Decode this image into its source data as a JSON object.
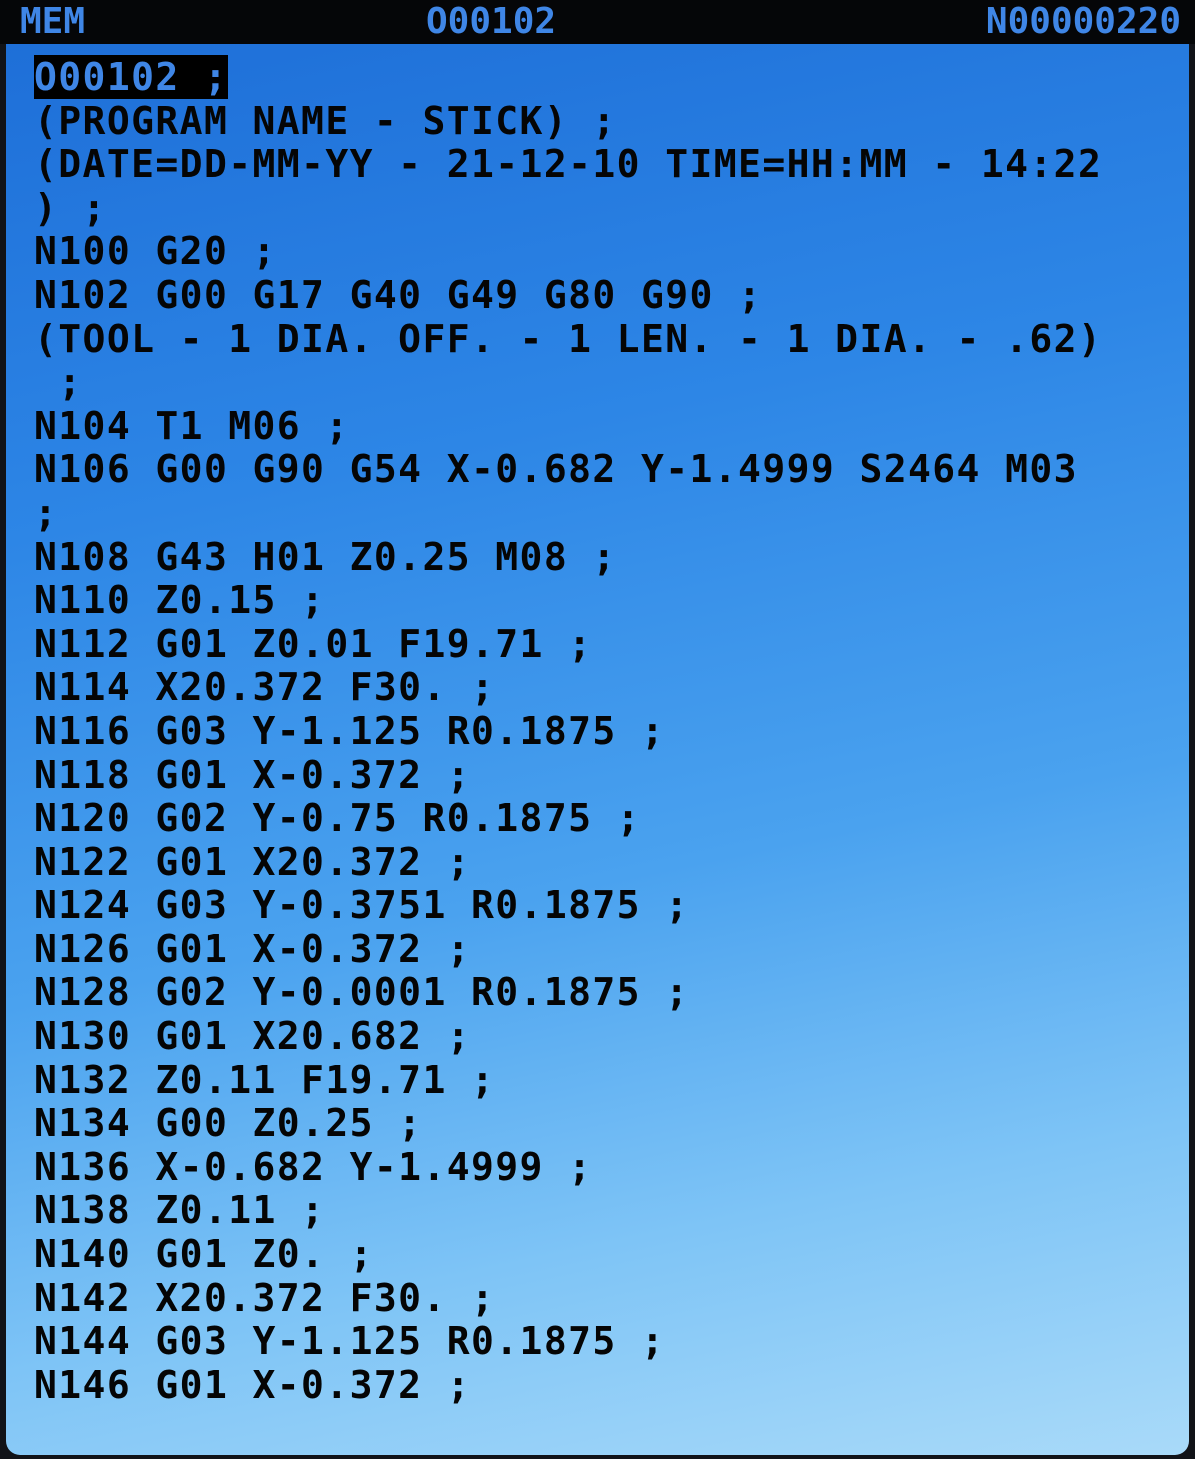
{
  "header": {
    "mode": "MEM",
    "program": "O00102",
    "sequence": "N00000220"
  },
  "program_lines": [
    "O00102 ;",
    "(PROGRAM NAME - STICK) ;",
    "(DATE=DD-MM-YY - 21-12-10 TIME=HH:MM - 14:22",
    ") ;",
    "N100 G20 ;",
    "N102 G00 G17 G40 G49 G80 G90 ;",
    "(TOOL - 1 DIA. OFF. - 1 LEN. - 1 DIA. - .62)",
    " ;",
    "N104 T1 M06 ;",
    "N106 G00 G90 G54 X-0.682 Y-1.4999 S2464 M03",
    ";",
    "N108 G43 H01 Z0.25 M08 ;",
    "N110 Z0.15 ;",
    "N112 G01 Z0.01 F19.71 ;",
    "N114 X20.372 F30. ;",
    "N116 G03 Y-1.125 R0.1875 ;",
    "N118 G01 X-0.372 ;",
    "N120 G02 Y-0.75 R0.1875 ;",
    "N122 G01 X20.372 ;",
    "N124 G03 Y-0.3751 R0.1875 ;",
    "N126 G01 X-0.372 ;",
    "N128 G02 Y-0.0001 R0.1875 ;",
    "N130 G01 X20.682 ;",
    "N132 Z0.11 F19.71 ;",
    "N134 G00 Z0.25 ;",
    "N136 X-0.682 Y-1.4999 ;",
    "N138 Z0.11 ;",
    "N140 G01 Z0. ;",
    "N142 X20.372 F30. ;",
    "N144 G03 Y-1.125 R0.1875 ;",
    "N146 G01 X-0.372 ;"
  ],
  "cursor_line": 0,
  "colors": {
    "header_background": "#050608",
    "header_text": "#3f86e6",
    "screen_gradient_top": "#1e6fd8",
    "screen_gradient_bottom": "#a9daf9",
    "program_text": "#050505",
    "cursor_background": "#000000"
  }
}
